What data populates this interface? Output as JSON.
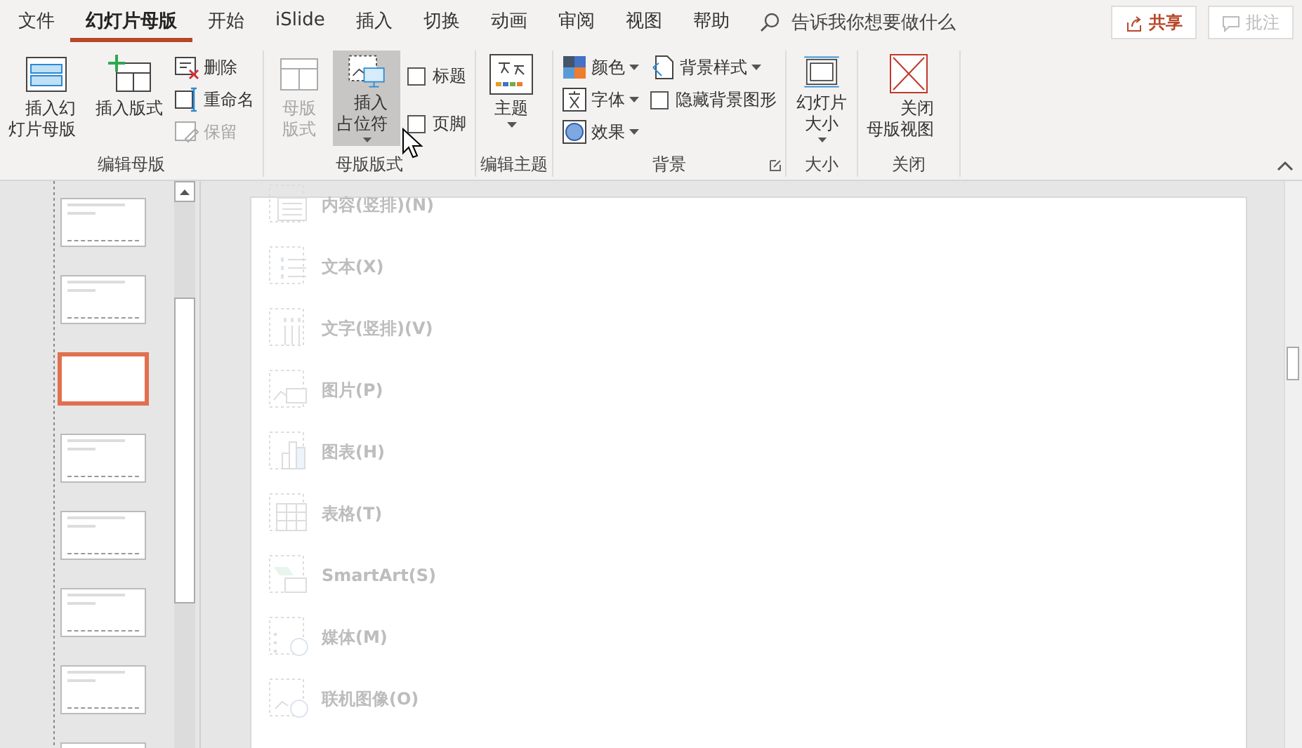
{
  "tabs": [
    {
      "label": "文件",
      "selected": false
    },
    {
      "label": "幻灯片母版",
      "selected": true
    },
    {
      "label": "开始",
      "selected": false
    },
    {
      "label": "iSlide",
      "selected": false
    },
    {
      "label": "插入",
      "selected": false
    },
    {
      "label": "切换",
      "selected": false
    },
    {
      "label": "动画",
      "selected": false
    },
    {
      "label": "审阅",
      "selected": false
    },
    {
      "label": "视图",
      "selected": false
    },
    {
      "label": "帮助",
      "selected": false
    }
  ],
  "search": {
    "placeholder": "告诉我你想要做什么"
  },
  "share_button": {
    "label": "共享"
  },
  "comment_button": {
    "label": "批注",
    "disabled": true
  },
  "ribbon_groups": [
    {
      "label": "编辑母版",
      "columns": [
        [
          {
            "kind": "large",
            "label": "插入幻灯片母版",
            "disabled": false,
            "pressed": false
          }
        ],
        [
          {
            "kind": "large",
            "label": "插入版式",
            "disabled": false,
            "pressed": false
          }
        ],
        [
          {
            "kind": "small",
            "label": "删除",
            "disabled": false
          },
          {
            "kind": "small",
            "label": "重命名",
            "disabled": false
          },
          {
            "kind": "small",
            "label": "保留",
            "disabled": true
          }
        ]
      ]
    },
    {
      "label": "母版版式",
      "columns": [
        [
          {
            "kind": "large",
            "label": "母版版式",
            "disabled": true,
            "pressed": false
          }
        ],
        [
          {
            "kind": "large",
            "label": "插入占位符",
            "disabled": false,
            "pressed": true,
            "dropdown": true
          }
        ],
        [
          {
            "kind": "checkbox",
            "label": "标题",
            "checked": false
          },
          {
            "kind": "checkbox",
            "label": "页脚",
            "checked": false
          }
        ]
      ]
    },
    {
      "label": "编辑主题",
      "columns": [
        [
          {
            "kind": "large",
            "label": "主题",
            "disabled": false,
            "pressed": false,
            "dropdown": true
          }
        ]
      ]
    },
    {
      "label": "背景",
      "launcher": true,
      "columns": [
        [
          {
            "kind": "small",
            "label": "颜色",
            "disabled": false,
            "dropdown": true
          },
          {
            "kind": "small",
            "label": "字体",
            "disabled": false,
            "dropdown": true
          },
          {
            "kind": "small",
            "label": "效果",
            "disabled": false,
            "dropdown": true
          }
        ],
        [
          {
            "kind": "small",
            "label": "背景样式",
            "disabled": false,
            "dropdown": true
          },
          {
            "kind": "checkbox",
            "label": "隐藏背景图形",
            "checked": false
          }
        ]
      ]
    },
    {
      "label": "大小",
      "columns": [
        [
          {
            "kind": "large",
            "label": "幻灯片大小",
            "disabled": false,
            "pressed": false,
            "dropdown": true
          }
        ]
      ]
    },
    {
      "label": "关闭",
      "columns": [
        [
          {
            "kind": "large",
            "label": "关闭母版视图",
            "disabled": false,
            "pressed": false
          }
        ]
      ]
    }
  ],
  "thumbnails": [
    {
      "selected": false
    },
    {
      "selected": false
    },
    {
      "selected": true
    },
    {
      "selected": false
    },
    {
      "selected": false
    },
    {
      "selected": false
    },
    {
      "selected": false
    },
    {
      "selected": false
    }
  ],
  "placeholder_menu": {
    "items": [
      {
        "label": "内容(竖排)(N)"
      },
      {
        "label": "文本(X)"
      },
      {
        "label": "文字(竖排)(V)"
      },
      {
        "label": "图片(P)"
      },
      {
        "label": "图表(H)"
      },
      {
        "label": "表格(T)"
      },
      {
        "label": "SmartArt(S)"
      },
      {
        "label": "媒体(M)"
      },
      {
        "label": "联机图像(O)"
      }
    ]
  }
}
